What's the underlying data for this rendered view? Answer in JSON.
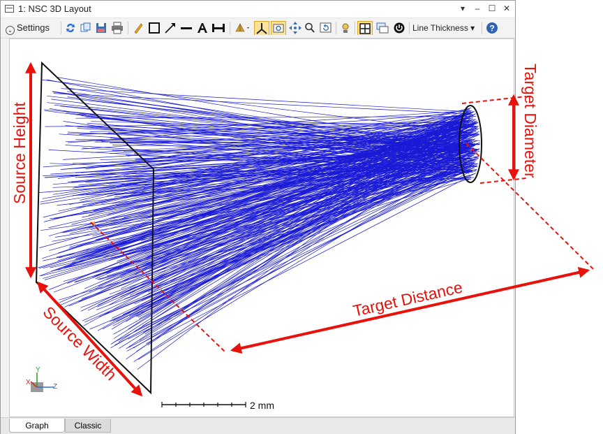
{
  "window": {
    "title": "1: NSC 3D Layout"
  },
  "window_controls": {
    "dropdown": "▾",
    "minimize": "–",
    "maximize": "☐",
    "close": "✕"
  },
  "toolbar": {
    "settings_label": "Settings",
    "settings_icon": "⌄",
    "line_thickness_label": "Line Thickness ▾",
    "help_icon": "?"
  },
  "annotations": {
    "source_height": "Source Height",
    "source_width": "Source Width",
    "target_diameter": "Target Diameter",
    "target_distance": "Target Distance",
    "color": "#e8120c"
  },
  "plot": {
    "scale_bar_label": "2 mm",
    "axis_x": "X",
    "axis_y": "Y",
    "axis_z": "Z",
    "ray_color": "#1a1ad6"
  },
  "tabs": [
    {
      "label": "Graph",
      "active": true
    },
    {
      "label": "Classic",
      "active": false
    }
  ]
}
